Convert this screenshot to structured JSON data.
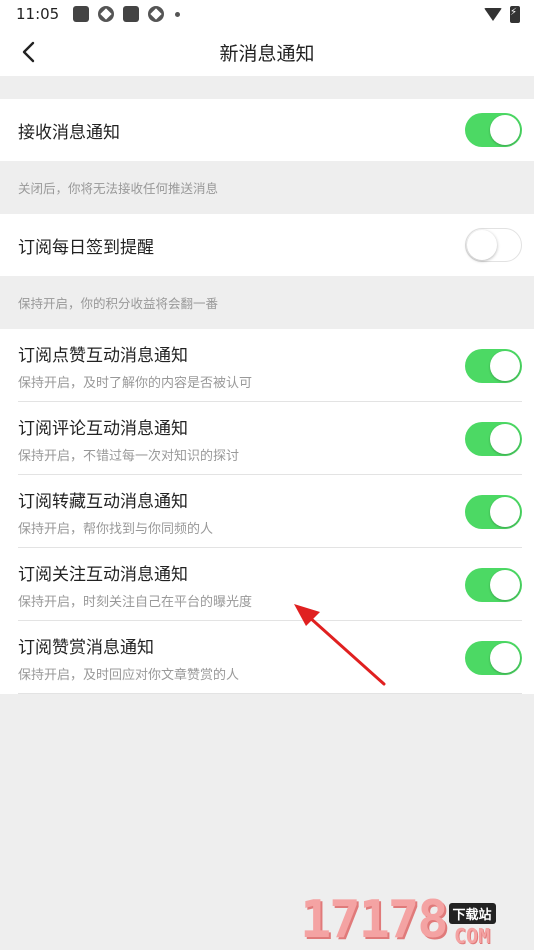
{
  "statusbar": {
    "time": "11:05"
  },
  "navbar": {
    "title": "新消息通知"
  },
  "sections": {
    "receive": {
      "label": "接收消息通知",
      "hint": "关闭后，你将无法接收任何推送消息",
      "on": true
    },
    "daily": {
      "label": "订阅每日签到提醒",
      "hint": "保持开启，你的积分收益将会翻一番",
      "on": false
    },
    "items": [
      {
        "label": "订阅点赞互动消息通知",
        "sub": "保持开启，及时了解你的内容是否被认可",
        "on": true
      },
      {
        "label": "订阅评论互动消息通知",
        "sub": "保持开启，不错过每一次对知识的探讨",
        "on": true
      },
      {
        "label": "订阅转藏互动消息通知",
        "sub": "保持开启，帮你找到与你同频的人",
        "on": true
      },
      {
        "label": "订阅关注互动消息通知",
        "sub": "保持开启，时刻关注自己在平台的曝光度",
        "on": true
      },
      {
        "label": "订阅赞赏消息通知",
        "sub": "保持开启，及时回应对你文章赞赏的人",
        "on": true
      }
    ]
  },
  "watermark": {
    "number": "17178",
    "badge": "下载站",
    "suffix": "COM"
  },
  "colors": {
    "toggle_on": "#4cd964",
    "background": "#eeeeee",
    "annotation_arrow": "#e02020"
  },
  "icons": [
    "back-arrow-icon",
    "wifi-icon",
    "battery-icon"
  ]
}
